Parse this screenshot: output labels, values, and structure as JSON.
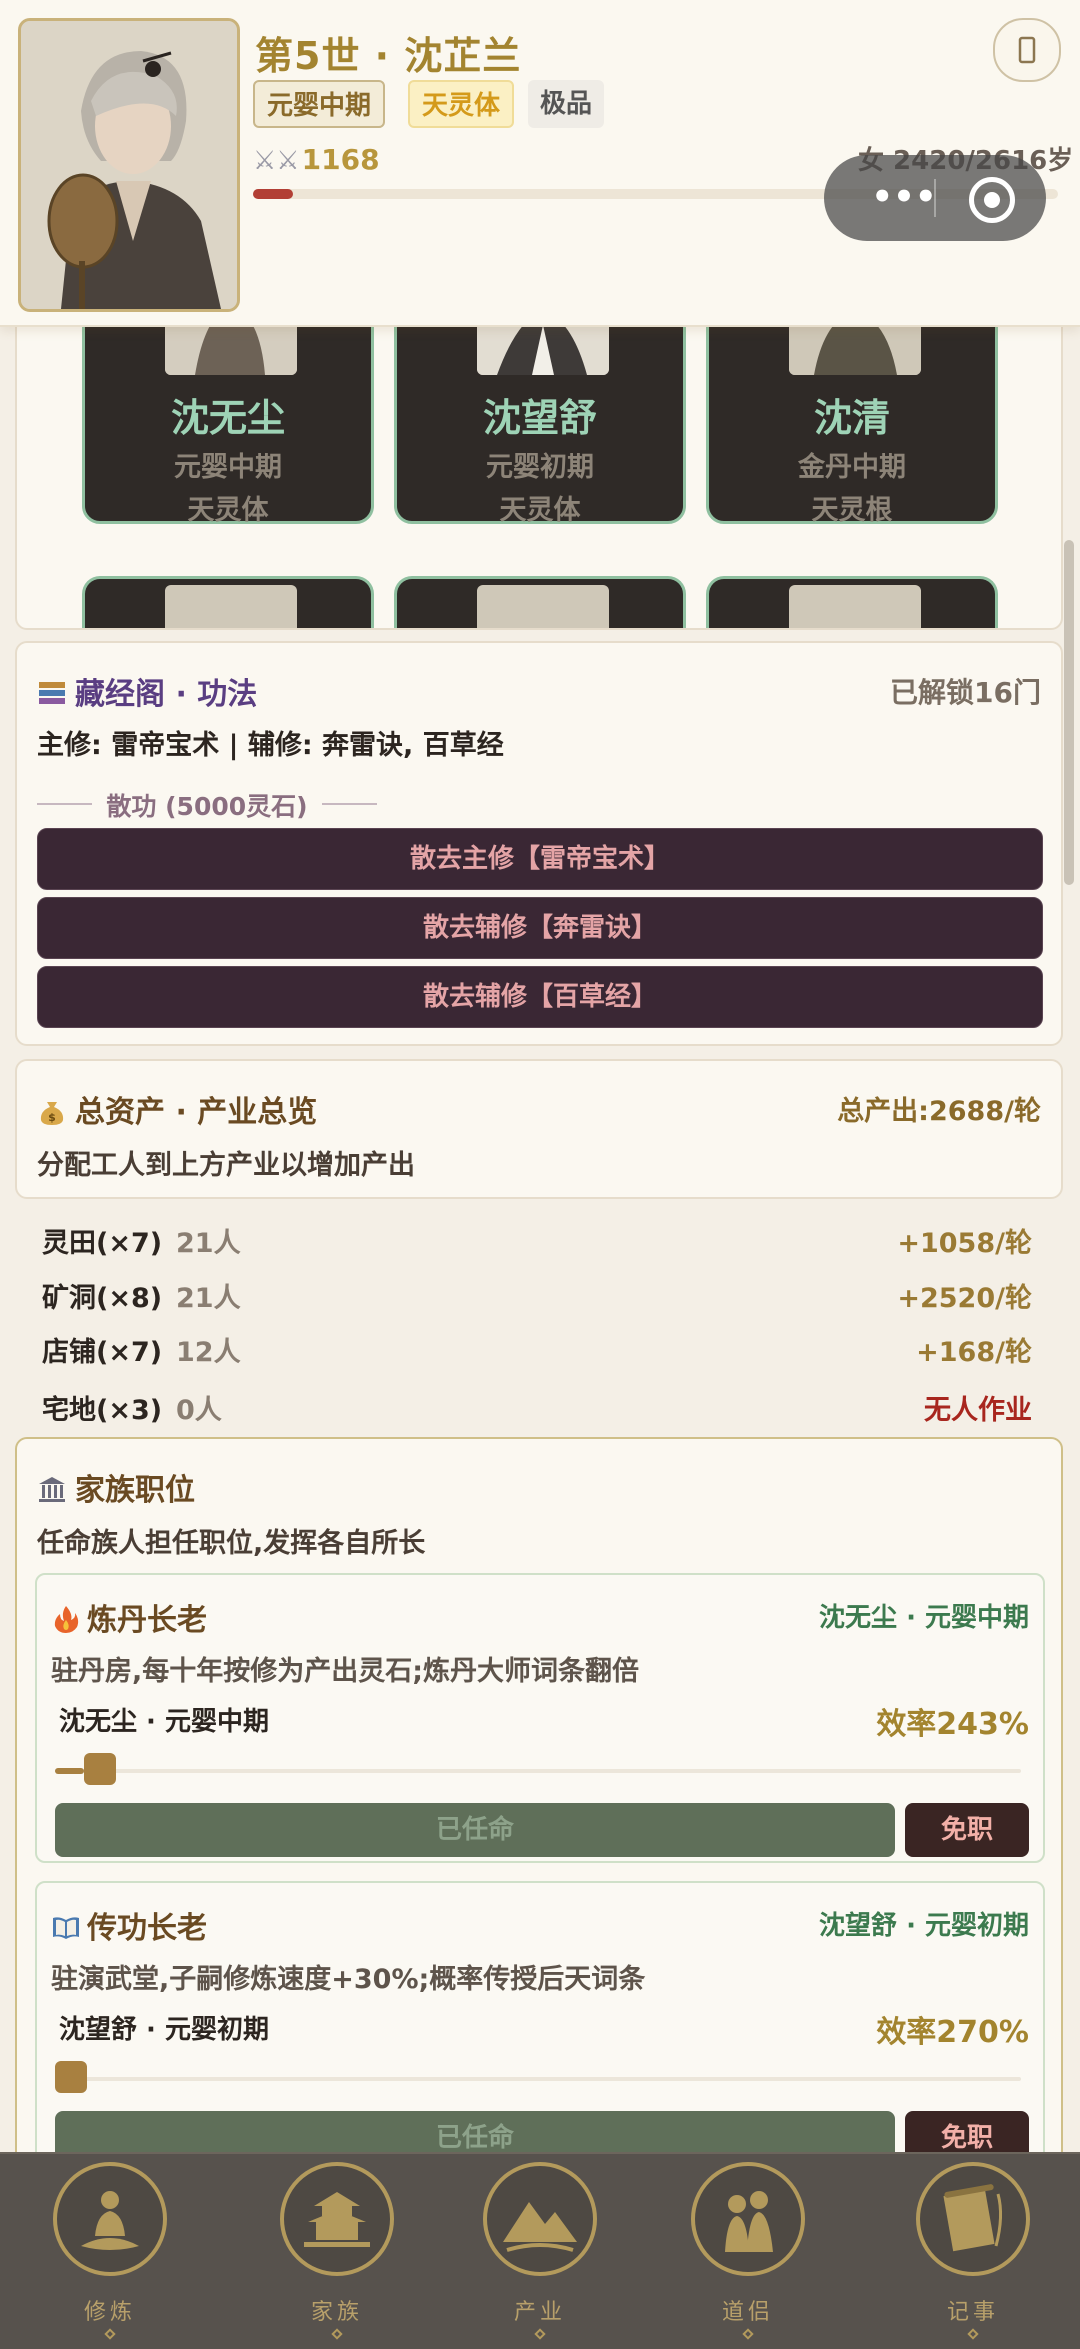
{
  "header": {
    "generation_title": "第5世 · 沈芷兰",
    "realm_tag": "元婴中期",
    "body_tag": "天灵体",
    "grade_tag": "极品",
    "combat_power": "1168",
    "gender_age": "女 2420/2616岁",
    "lifespan_fraction": 0.05,
    "menu_icon": "more-dots-icon",
    "close_icon": "target-circle-icon"
  },
  "members": {
    "row1": [
      {
        "name": "沈无尘",
        "realm": "元婴中期",
        "body": "天灵体"
      },
      {
        "name": "沈望舒",
        "realm": "元婴初期",
        "body": "天灵体"
      },
      {
        "name": "沈清",
        "realm": "金丹中期",
        "body": "天灵根"
      }
    ]
  },
  "library": {
    "title": "藏经阁 · 功法",
    "unlocked": "已解锁16门",
    "main_sub": "主修: 雷帝宝术 | 辅修: 奔雷诀, 百草经",
    "dispel_label": "散功 (5000灵石)",
    "buttons": [
      "散去主修【雷帝宝术】",
      "散去辅修【奔雷诀】",
      "散去辅修【百草经】"
    ]
  },
  "assets": {
    "title": "总资产 · 产业总览",
    "total": "总产出:2688/轮",
    "desc": "分配工人到上方产业以增加产出",
    "industries": [
      {
        "name": "灵田(×7)",
        "workers": "21人",
        "output": "+1058/轮"
      },
      {
        "name": "矿洞(×8)",
        "workers": "21人",
        "output": "+2520/轮"
      },
      {
        "name": "店铺(×7)",
        "workers": "12人",
        "output": "+168/轮"
      },
      {
        "name": "宅地(×3)",
        "workers": "0人",
        "output": "无人作业"
      }
    ]
  },
  "positions": {
    "title": "家族职位",
    "desc": "任命族人担任职位,发挥各自所长",
    "cards": [
      {
        "title": "炼丹长老",
        "holder": "沈无尘 · 元婴中期",
        "desc": "驻丹房,每十年按修为产出灵石;炼丹大师词条翻倍",
        "selected": "沈无尘 · 元婴中期",
        "efficiency": "效率243%",
        "slider_fraction": 0.03,
        "appoint_label": "已任命",
        "dismiss_label": "免职",
        "icon": "fire-icon"
      },
      {
        "title": "传功长老",
        "holder": "沈望舒 · 元婴初期",
        "desc": "驻演武堂,子嗣修炼速度+30%;概率传授后天词条",
        "selected": "沈望舒 · 元婴初期",
        "efficiency": "效率270%",
        "slider_fraction": 0.0,
        "appoint_label": "已任命",
        "dismiss_label": "免职",
        "icon": "book-icon"
      }
    ]
  },
  "nav": [
    {
      "label": "修炼",
      "icon": "meditation-icon"
    },
    {
      "label": "家族",
      "icon": "pagoda-icon"
    },
    {
      "label": "产业",
      "icon": "mountain-icon"
    },
    {
      "label": "道侣",
      "icon": "couple-icon"
    },
    {
      "label": "记事",
      "icon": "scroll-icon"
    }
  ],
  "colors": {
    "accent_gold": "#a38430",
    "member_name": "#9ed3b6",
    "dispel_bg": "#3a2734",
    "nav_bg": "#57524d"
  }
}
